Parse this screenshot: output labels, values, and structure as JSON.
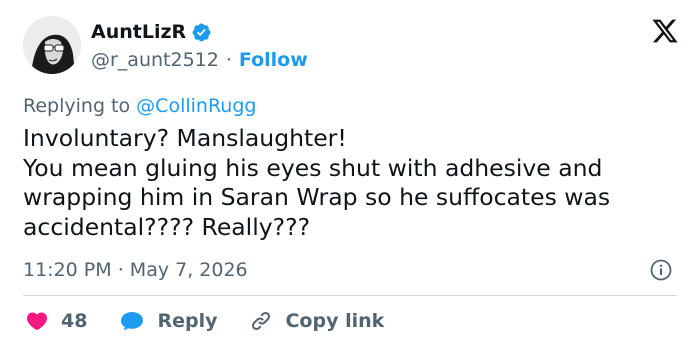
{
  "author": {
    "name": "AuntLizR",
    "handle": "@r_aunt2512",
    "separator": "·",
    "follow_label": "Follow"
  },
  "reply": {
    "prefix": "Replying to",
    "mention": "@CollinRugg"
  },
  "tweet_text": "Involuntary? Manslaughter!\nYou mean gluing his eyes shut with adhesive and wrapping him in Saran Wrap so he suffocates was accidental???? Really???",
  "meta": {
    "time": "11:20 PM",
    "separator": "·",
    "date": "May 7, 2026"
  },
  "actions": {
    "like_count": "48",
    "reply_label": "Reply",
    "copy_link_label": "Copy link"
  },
  "colors": {
    "accent": "#1d9bf0",
    "like": "#f91880",
    "secondary_text": "#536471",
    "primary_text": "#0f1419"
  },
  "icons": [
    "verified-badge-icon",
    "x-logo-icon",
    "info-icon",
    "heart-icon",
    "reply-bubble-icon",
    "link-icon"
  ]
}
